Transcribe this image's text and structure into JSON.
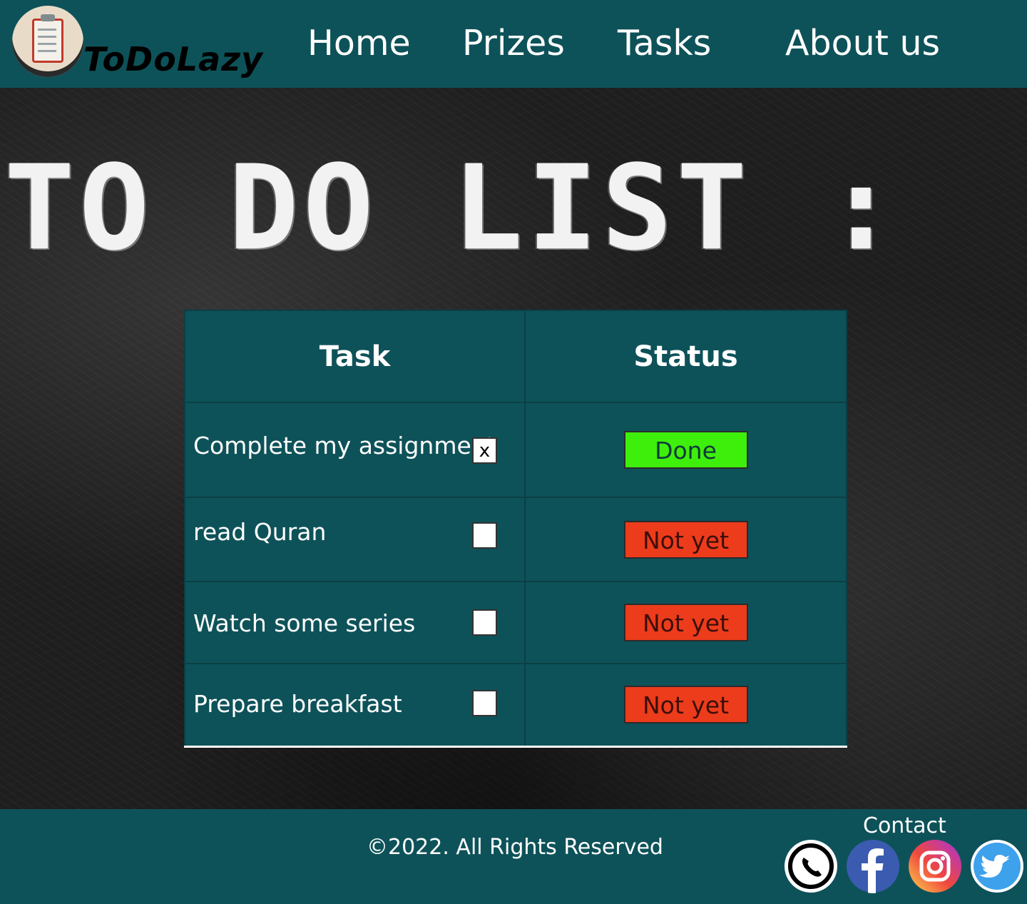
{
  "header": {
    "brand": "ToDoLazy",
    "nav": [
      {
        "label": "Home"
      },
      {
        "label": "Prizes"
      },
      {
        "label": "Tasks"
      },
      {
        "label": "About us"
      }
    ]
  },
  "board": {
    "title": "TO DO LIST :"
  },
  "table": {
    "headers": {
      "task": "Task",
      "status": "Status"
    },
    "rows": [
      {
        "task": "Complete my assignment",
        "checked": true,
        "check_mark": "x",
        "status": "Done"
      },
      {
        "task": "read Quran",
        "checked": false,
        "check_mark": "",
        "status": "Not yet"
      },
      {
        "task": "Watch some series",
        "checked": false,
        "check_mark": "",
        "status": "Not yet"
      },
      {
        "task": "Prepare breakfast",
        "checked": false,
        "check_mark": "",
        "status": "Not yet"
      }
    ]
  },
  "footer": {
    "copyright": "©2022. All Rights Reserved",
    "contact_label": "Contact",
    "social": [
      "whatsapp-icon",
      "facebook-icon",
      "instagram-icon",
      "twitter-icon"
    ]
  },
  "colors": {
    "header_bg": "#0e5259",
    "done": "#3fef0c",
    "not_yet": "#ec3c1c"
  }
}
